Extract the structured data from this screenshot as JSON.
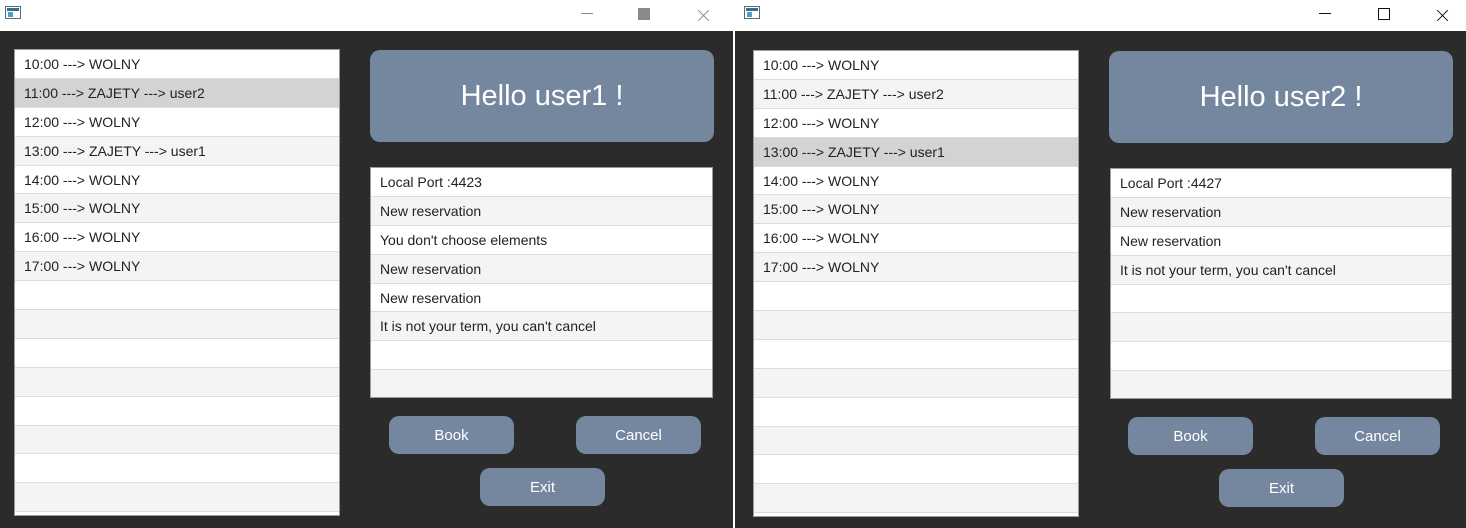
{
  "windows": [
    {
      "greeting": "Hello user1 !",
      "slots": [
        "10:00 ---> WOLNY",
        "11:00 ---> ZAJETY ---> user2",
        "12:00 ---> WOLNY",
        "13:00 ---> ZAJETY ---> user1",
        "14:00 ---> WOLNY",
        "15:00 ---> WOLNY",
        "16:00 ---> WOLNY",
        "17:00 ---> WOLNY",
        "",
        "",
        "",
        "",
        "",
        "",
        "",
        ""
      ],
      "selected_slot": 1,
      "log": [
        "Local Port :4423",
        "New reservation",
        "You don't choose elements",
        "New reservation",
        "New reservation",
        "It is not your term, you can't cancel",
        "",
        ""
      ],
      "buttons": {
        "book": "Book",
        "cancel": "Cancel",
        "exit": "Exit"
      }
    },
    {
      "greeting": "Hello user2 !",
      "slots": [
        "10:00 ---> WOLNY",
        "11:00 ---> ZAJETY ---> user2",
        "12:00 ---> WOLNY",
        "13:00 ---> ZAJETY ---> user1",
        "14:00 ---> WOLNY",
        "15:00 ---> WOLNY",
        "16:00 ---> WOLNY",
        "17:00 ---> WOLNY",
        "",
        "",
        "",
        "",
        "",
        "",
        "",
        ""
      ],
      "selected_slot": 3,
      "log": [
        "Local Port :4427",
        "New reservation",
        "New reservation",
        "It is not your term, you can't cancel",
        "",
        "",
        "",
        ""
      ],
      "buttons": {
        "book": "Book",
        "cancel": "Cancel",
        "exit": "Exit"
      }
    }
  ],
  "colors": {
    "accent": "#74879f",
    "background": "#2b2b2b",
    "selection": "#d3d3d3"
  }
}
